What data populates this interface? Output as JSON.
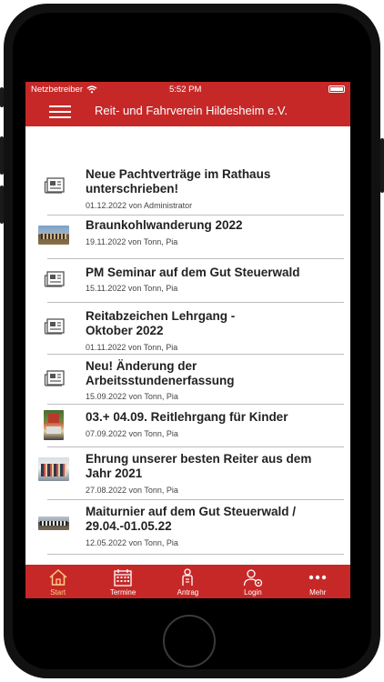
{
  "statusbar": {
    "carrier": "Netzbetreiber",
    "time": "5:52 PM"
  },
  "navbar": {
    "title": "Reit- und Fahrverein Hildesheim e.V."
  },
  "news": [
    {
      "title": "Neue Pachtverträge im Rathaus unterschrieben!",
      "meta": "01.12.2022 von Administrator",
      "thumb": "newspaper-icon"
    },
    {
      "title": "Braunkohlwanderung 2022",
      "meta": "19.11.2022 von Tonn, Pia",
      "thumb": "photo"
    },
    {
      "title": "PM Seminar auf dem Gut Steuerwald",
      "meta": "15.11.2022 von Tonn, Pia",
      "thumb": "newspaper-icon"
    },
    {
      "title": "Reitabzeichen Lehrgang - Oktober 2022",
      "meta": "01.11.2022 von Tonn, Pia",
      "thumb": "newspaper-icon"
    },
    {
      "title": "Neu! Änderung der Arbeitsstundenerfassung",
      "meta": "15.09.2022 von Tonn, Pia",
      "thumb": "newspaper-icon"
    },
    {
      "title": "03.+ 04.09. Reitlehrgang für Kinder",
      "meta": "07.09.2022 von Tonn, Pia",
      "thumb": "photo"
    },
    {
      "title": "Ehrung unserer besten Reiter aus dem Jahr 2021",
      "meta": "27.08.2022 von Tonn, Pia",
      "thumb": "photo"
    },
    {
      "title": "Maiturnier auf dem Gut Steuerwald / 29.04.-01.05.22",
      "meta": "12.05.2022 von Tonn, Pia",
      "thumb": "photo"
    }
  ],
  "tabs": [
    {
      "label": "Start",
      "icon": "home-icon",
      "active": true
    },
    {
      "label": "Termine",
      "icon": "calendar-icon",
      "active": false
    },
    {
      "label": "Antrag",
      "icon": "form-person-icon",
      "active": false
    },
    {
      "label": "Login",
      "icon": "user-icon",
      "active": false
    },
    {
      "label": "Mehr",
      "icon": "more-icon",
      "active": false
    }
  ],
  "colors": {
    "accent": "#c62828",
    "active_tab": "#ffcc80"
  }
}
